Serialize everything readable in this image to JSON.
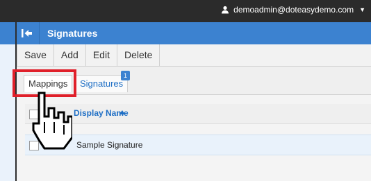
{
  "topbar": {
    "user_label": "demoadmin@doteasydemo.com",
    "icons": [
      "user-icon",
      "caret-down-icon"
    ]
  },
  "panel": {
    "title": "Signatures",
    "collapse_icon": "collapse-left-icon"
  },
  "toolbar": {
    "buttons": [
      "Save",
      "Add",
      "Edit",
      "Delete"
    ]
  },
  "tabs": {
    "items": [
      {
        "label": "Mappings"
      },
      {
        "label": "Signatures",
        "badge": "1"
      }
    ]
  },
  "grid": {
    "column": "Display Name",
    "rows": [
      {
        "label": "Sample Signature"
      }
    ]
  },
  "colors": {
    "accent": "#3c82d0",
    "highlight": "#e0202a",
    "link": "#1f6fc5"
  }
}
